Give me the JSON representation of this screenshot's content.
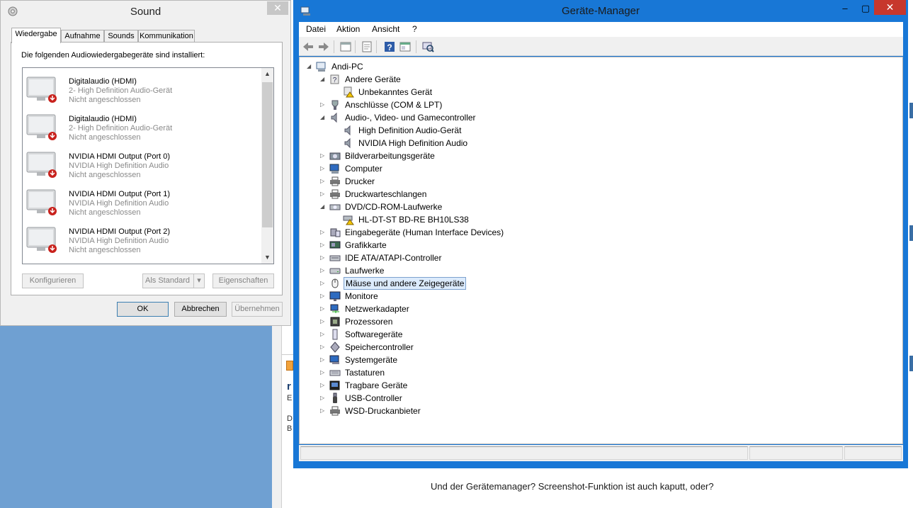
{
  "sound": {
    "title": "Sound",
    "tabs": [
      "Wiedergabe",
      "Aufnahme",
      "Sounds",
      "Kommunikation"
    ],
    "active_tab": "Wiedergabe",
    "intro": "Die folgenden Audiowiedergabegeräte sind installiert:",
    "devices": [
      {
        "name": "Digitalaudio (HDMI)",
        "description": "2- High Definition Audio-Gerät",
        "status": "Nicht angeschlossen"
      },
      {
        "name": "Digitalaudio (HDMI)",
        "description": "2- High Definition Audio-Gerät",
        "status": "Nicht angeschlossen"
      },
      {
        "name": "NVIDIA HDMI Output (Port 0)",
        "description": "NVIDIA High Definition Audio",
        "status": "Nicht angeschlossen"
      },
      {
        "name": "NVIDIA HDMI Output (Port 1)",
        "description": "NVIDIA High Definition Audio",
        "status": "Nicht angeschlossen"
      },
      {
        "name": "NVIDIA HDMI Output (Port 2)",
        "description": "NVIDIA High Definition Audio",
        "status": "Nicht angeschlossen"
      }
    ],
    "buttons": {
      "configure": "Konfigurieren",
      "set_default": "Als Standard",
      "properties": "Eigenschaften",
      "ok": "OK",
      "cancel": "Abbrechen",
      "apply": "Übernehmen"
    }
  },
  "device_manager": {
    "title": "Geräte-Manager",
    "menu": [
      "Datei",
      "Aktion",
      "Ansicht",
      "?"
    ],
    "root": "Andi-PC",
    "tree": [
      {
        "label": "Andere Geräte",
        "icon": "unknown-device-icon",
        "expanded": true,
        "children": [
          {
            "label": "Unbekanntes Gerät",
            "icon": "warning-device-icon"
          }
        ]
      },
      {
        "label": "Anschlüsse (COM & LPT)",
        "icon": "port-icon",
        "expanded": false
      },
      {
        "label": "Audio-, Video- und Gamecontroller",
        "icon": "speaker-icon",
        "expanded": true,
        "children": [
          {
            "label": "High Definition Audio-Gerät",
            "icon": "speaker-icon"
          },
          {
            "label": "NVIDIA High Definition Audio",
            "icon": "speaker-icon"
          }
        ]
      },
      {
        "label": "Bildverarbeitungsgeräte",
        "icon": "camera-icon",
        "expanded": false
      },
      {
        "label": "Computer",
        "icon": "computer-icon",
        "expanded": false
      },
      {
        "label": "Drucker",
        "icon": "printer-icon",
        "expanded": false
      },
      {
        "label": "Druckwarteschlangen",
        "icon": "printer-icon",
        "expanded": false
      },
      {
        "label": "DVD/CD-ROM-Laufwerke",
        "icon": "optical-drive-icon",
        "expanded": true,
        "children": [
          {
            "label": "HL-DT-ST BD-RE  BH10LS38",
            "icon": "warning-drive-icon"
          }
        ]
      },
      {
        "label": "Eingabegeräte (Human Interface Devices)",
        "icon": "hid-icon",
        "expanded": false
      },
      {
        "label": "Grafikkarte",
        "icon": "display-adapter-icon",
        "expanded": false
      },
      {
        "label": "IDE ATA/ATAPI-Controller",
        "icon": "ide-controller-icon",
        "expanded": false
      },
      {
        "label": "Laufwerke",
        "icon": "disk-drive-icon",
        "expanded": false
      },
      {
        "label": "Mäuse und andere Zeigegeräte",
        "icon": "mouse-icon",
        "expanded": false,
        "selected": true
      },
      {
        "label": "Monitore",
        "icon": "monitor-icon",
        "expanded": false
      },
      {
        "label": "Netzwerkadapter",
        "icon": "network-adapter-icon",
        "expanded": false
      },
      {
        "label": "Prozessoren",
        "icon": "processor-icon",
        "expanded": false
      },
      {
        "label": "Softwaregeräte",
        "icon": "software-device-icon",
        "expanded": false
      },
      {
        "label": "Speichercontroller",
        "icon": "storage-controller-icon",
        "expanded": false
      },
      {
        "label": "Systemgeräte",
        "icon": "system-device-icon",
        "expanded": false
      },
      {
        "label": "Tastaturen",
        "icon": "keyboard-icon",
        "expanded": false
      },
      {
        "label": "Tragbare Geräte",
        "icon": "portable-device-icon",
        "expanded": false
      },
      {
        "label": "USB-Controller",
        "icon": "usb-icon",
        "expanded": false
      },
      {
        "label": "WSD-Druckanbieter",
        "icon": "printer-icon",
        "expanded": false
      }
    ]
  },
  "background": {
    "post_text": "Und der Gerätemanager? Screenshot-Funktion ist auch kaputt, oder?",
    "card_letters": [
      "r",
      "E",
      "D",
      "B"
    ]
  },
  "colors": {
    "devmgr_frame": "#1877d6",
    "desktop_blue": "#6fa0d2",
    "close_red": "#c7372c",
    "selection_bg": "#dcebfc"
  }
}
